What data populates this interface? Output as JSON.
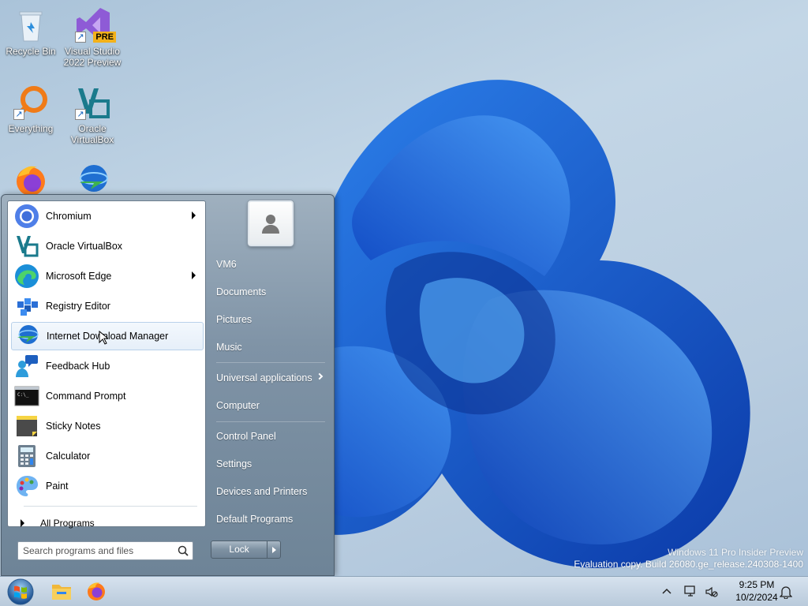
{
  "desktop": {
    "icons": [
      {
        "label": "Recycle Bin"
      },
      {
        "label": "Visual Studio 2022 Preview",
        "badge": "PRE"
      },
      {
        "label": "Everything"
      },
      {
        "label": "Oracle VirtualBox"
      },
      {
        "label": ""
      },
      {
        "label": ""
      }
    ]
  },
  "start_menu": {
    "programs": [
      {
        "label": "Chromium",
        "has_submenu": true,
        "icon": "chromium-icon"
      },
      {
        "label": "Oracle VirtualBox",
        "has_submenu": false,
        "icon": "virtualbox-icon"
      },
      {
        "label": "Microsoft Edge",
        "has_submenu": true,
        "icon": "edge-icon"
      },
      {
        "label": "Registry Editor",
        "has_submenu": false,
        "icon": "registry-editor-icon"
      },
      {
        "label": "Internet Download Manager",
        "has_submenu": false,
        "icon": "idm-icon"
      },
      {
        "label": "Feedback Hub",
        "has_submenu": false,
        "icon": "feedback-hub-icon"
      },
      {
        "label": "Command Prompt",
        "has_submenu": false,
        "icon": "command-prompt-icon"
      },
      {
        "label": "Sticky Notes",
        "has_submenu": false,
        "icon": "sticky-notes-icon"
      },
      {
        "label": "Calculator",
        "has_submenu": false,
        "icon": "calculator-icon"
      },
      {
        "label": "Paint",
        "has_submenu": false,
        "icon": "paint-icon"
      }
    ],
    "all_programs_label": "All Programs",
    "search_placeholder": "Search programs and files",
    "right_items": [
      {
        "label": "VM6"
      },
      {
        "label": "Documents"
      },
      {
        "label": "Pictures"
      },
      {
        "label": "Music"
      },
      {
        "label": "Universal applications",
        "has_submenu": true
      },
      {
        "label": "Computer"
      },
      {
        "label": "Control Panel"
      },
      {
        "label": "Settings"
      },
      {
        "label": "Devices and Printers"
      },
      {
        "label": "Default Programs"
      }
    ],
    "lock_label": "Lock"
  },
  "watermark": {
    "line1": "Windows 11 Pro Insider Preview",
    "line2": "Evaluation copy. Build 26080.ge_release.240308-1400"
  },
  "taskbar": {
    "time": "9:25 PM",
    "date": "10/2/2024"
  },
  "colors": {
    "accent": "#1e6fd9",
    "bloom_dark": "#0a3fb0",
    "bloom_light": "#3a8cf0"
  }
}
